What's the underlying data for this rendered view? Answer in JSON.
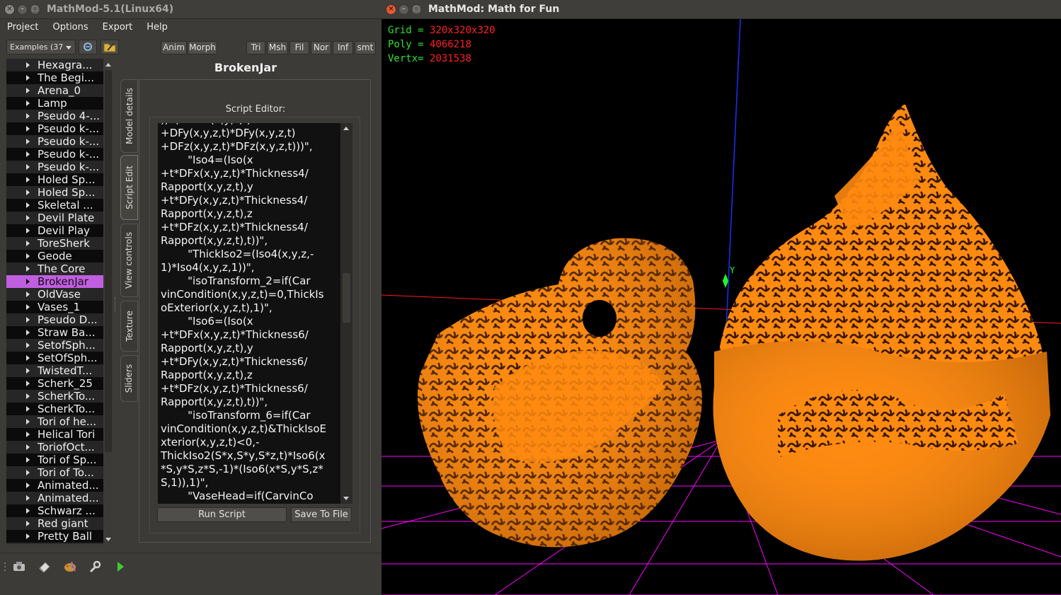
{
  "left_window": {
    "title": "MathMod-5.1(Linux64)",
    "menu": [
      "Project",
      "Options",
      "Export",
      "Help"
    ],
    "examples_combo": "Examples (37",
    "buttons_group1": [
      "Anim",
      "Morph"
    ],
    "buttons_group2": [
      "Tri",
      "Msh",
      "Fil",
      "Nor",
      "Inf",
      "smt"
    ],
    "model_title": "BrokenJar",
    "tabs": [
      "Model details",
      "Script Edit",
      "View controls",
      "Texture",
      "Sliders"
    ],
    "script_editor_label": "Script Editor:",
    "run_script": "Run Script",
    "save_to_file": "Save To File",
    "list_items": [
      "Hexagra...",
      "The Begi...",
      "Arena_0",
      "Lamp",
      "Pseudo 4-...",
      "Pseudo k-...",
      "Pseudo k-...",
      "Pseudo k-...",
      "Pseudo k-...",
      "Holed Sp...",
      "Holed Sp...",
      "Skeletal ...",
      "Devil Plate",
      "Devil Play",
      "ToreSherk",
      "Geode",
      "The Core",
      "BrokenJar",
      "OldVase",
      "Vases_1",
      "Pseudo D...",
      "Straw Ba...",
      "SetofSph...",
      "SetOfSph...",
      "TwistedT...",
      "Scherk_25",
      "ScherkTo...",
      "ScherkTo...",
      "Tori of he...",
      "Helical Tori",
      "ToriofOct...",
      "Tori of Sp...",
      "Tori of To...",
      "Animated...",
      "Animated...",
      "Schwarz ...",
      "Red giant",
      "Pretty Ball"
    ],
    "selected_item": "BrokenJar",
    "script_lines": [
      "), t, - DFx(x,y,z,t)",
      "+DFy(x,y,z,t)*DFy(x,y,z,t)",
      "+DFz(x,y,z,t)*DFz(x,y,z,t)))\",",
      "        \"Iso4=(Iso(x",
      "+t*DFx(x,y,z,t)*Thickness4/",
      "Rapport(x,y,z,t),y",
      "+t*DFy(x,y,z,t)*Thickness4/",
      "Rapport(x,y,z,t),z",
      "+t*DFz(x,y,z,t)*Thickness4/",
      "Rapport(x,y,z,t),t))\",",
      "        \"ThickIso2=(Iso4(x,y,z,-",
      "1)*Iso4(x,y,z,1))\",",
      "        \"isoTransform_2=if(Car",
      "vinCondition(x,y,z,t)=0,ThickIs",
      "oExterior(x,y,z,t),1)\",",
      "        \"Iso6=(Iso(x",
      "+t*DFx(x,y,z,t)*Thickness6/",
      "Rapport(x,y,z,t),y",
      "+t*DFy(x,y,z,t)*Thickness6/",
      "Rapport(x,y,z,t),z",
      "+t*DFz(x,y,z,t)*Thickness6/",
      "Rapport(x,y,z,t),t))\",",
      "        \"isoTransform_6=if(Car",
      "vinCondition(x,y,z,t)&ThickIsoE",
      "xterior(x,y,z,t)<0,-",
      "ThickIso2(S*x,S*y,S*z,t)*Iso6(x",
      "*S,y*S,z*S,-1)*(Iso6(x*S,y*S,z*",
      "S,1)),1)\",",
      "        \"VaseHead=if(CarvinCo"
    ]
  },
  "right_window": {
    "title": "MathMod: Math for Fun",
    "stats": [
      {
        "key": "Grid =",
        "value": "320x320x320"
      },
      {
        "key": "Poly =",
        "value": "4066218"
      },
      {
        "key": "Vertx=",
        "value": "2031538"
      }
    ],
    "axis_label_y": "Y"
  },
  "colors": {
    "selection": "#c05ee0",
    "surface": "#ff8a10",
    "grid": "#ff00ff",
    "stats_key": "#2ee02e",
    "stats_value": "#ff2020"
  },
  "icons": [
    "camera-icon",
    "eraser-icon",
    "palette-icon",
    "wrench-icon",
    "play-icon"
  ]
}
